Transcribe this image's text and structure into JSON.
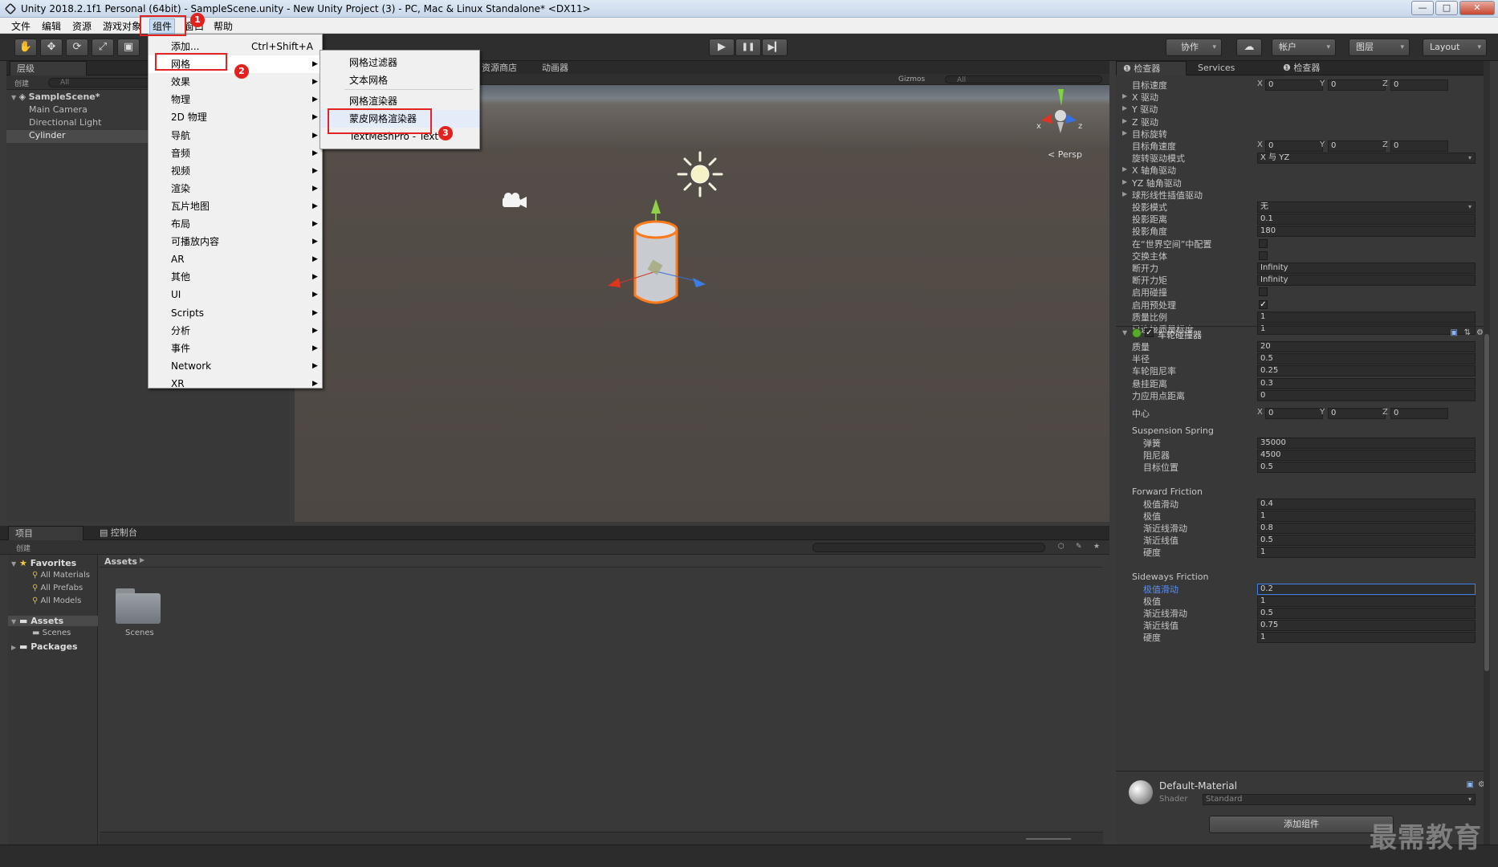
{
  "window": {
    "title": "Unity 2018.2.1f1 Personal (64bit) - SampleScene.unity - New Unity Project (3) - PC, Mac & Linux Standalone* <DX11>",
    "minimize": "—",
    "maximize": "□",
    "close": "✕"
  },
  "menubar": {
    "items": [
      "文件",
      "编辑",
      "资源",
      "游戏对象",
      "组件",
      "窗口",
      "帮助"
    ]
  },
  "toolbar": {
    "play": "▶",
    "pause": "❚❚",
    "step": "▶▎",
    "collab": "协作",
    "cloud": "☁",
    "account": "帐户",
    "layers": "图层",
    "layout": "Layout"
  },
  "hierarchy": {
    "tab": "层级",
    "create": "创建",
    "search_placeholder": "All",
    "scene": "SampleScene*",
    "items": [
      "Main Camera",
      "Directional Light",
      "Cylinder"
    ]
  },
  "scene_view": {
    "tabs": [
      "资源商店",
      "动画器"
    ],
    "gizmos": "Gizmos",
    "search_placeholder": "All",
    "persp_label": "Persp",
    "axis_x": "x",
    "axis_z": "z"
  },
  "component_menu": {
    "items": [
      {
        "label": "添加...",
        "shortcut": "Ctrl+Shift+A",
        "submenu": false
      },
      {
        "label": "网格",
        "submenu": true
      },
      {
        "label": "效果",
        "submenu": true
      },
      {
        "label": "物理",
        "submenu": true
      },
      {
        "label": "2D 物理",
        "submenu": true
      },
      {
        "label": "导航",
        "submenu": true
      },
      {
        "label": "音频",
        "submenu": true
      },
      {
        "label": "视频",
        "submenu": true
      },
      {
        "label": "渲染",
        "submenu": true
      },
      {
        "label": "瓦片地图",
        "submenu": true
      },
      {
        "label": "布局",
        "submenu": true
      },
      {
        "label": "可播放内容",
        "submenu": true
      },
      {
        "label": "AR",
        "submenu": true
      },
      {
        "label": "其他",
        "submenu": true
      },
      {
        "label": "UI",
        "submenu": true
      },
      {
        "label": "Scripts",
        "submenu": true
      },
      {
        "label": "分析",
        "submenu": true
      },
      {
        "label": "事件",
        "submenu": true
      },
      {
        "label": "Network",
        "submenu": true
      },
      {
        "label": "XR",
        "submenu": true
      }
    ]
  },
  "mesh_submenu": {
    "items": [
      "网格过滤器",
      "文本网格",
      "网格渲染器",
      "蒙皮网格渲染器",
      "TextMeshPro - Text"
    ]
  },
  "annotations": [
    "1",
    "2",
    "3"
  ],
  "inspector": {
    "tabs": [
      "检查器",
      "Services",
      "检查器"
    ],
    "rows": [
      {
        "label": "目标速度",
        "type": "xyz",
        "x": "0",
        "y": "0",
        "z": "0"
      },
      {
        "label": "X 驱动",
        "type": "fold"
      },
      {
        "label": "Y 驱动",
        "type": "fold"
      },
      {
        "label": "Z 驱动",
        "type": "fold"
      },
      {
        "label": "目标旋转",
        "type": "fold"
      },
      {
        "label": "目标角速度",
        "type": "xyz",
        "x": "0",
        "y": "0",
        "z": "0"
      },
      {
        "label": "旋转驱动模式",
        "type": "dropdown",
        "value": "X 与 YZ"
      },
      {
        "label": "X 轴角驱动",
        "type": "fold"
      },
      {
        "label": "YZ 轴角驱动",
        "type": "fold"
      },
      {
        "label": "球形线性插值驱动",
        "type": "fold"
      },
      {
        "label": "投影模式",
        "type": "dropdown",
        "value": "无"
      },
      {
        "label": "投影距离",
        "type": "field",
        "value": "0.1"
      },
      {
        "label": "投影角度",
        "type": "field",
        "value": "180"
      },
      {
        "label": "在“世界空间”中配置",
        "type": "check",
        "checked": false
      },
      {
        "label": "交换主体",
        "type": "check",
        "checked": false
      },
      {
        "label": "断开力",
        "type": "field",
        "value": "Infinity"
      },
      {
        "label": "断开力矩",
        "type": "field",
        "value": "Infinity"
      },
      {
        "label": "启用碰撞",
        "type": "check",
        "checked": false
      },
      {
        "label": "启用预处理",
        "type": "check",
        "checked": true
      },
      {
        "label": "质量比例",
        "type": "field",
        "value": "1"
      },
      {
        "label": "已连接质量标度",
        "type": "field",
        "value": "1"
      }
    ],
    "wheel_collider": {
      "title": "车轮碰撞器",
      "rows": [
        {
          "label": "质量",
          "value": "20"
        },
        {
          "label": "半径",
          "value": "0.5"
        },
        {
          "label": "车轮阻尼率",
          "value": "0.25"
        },
        {
          "label": "悬挂距离",
          "value": "0.3"
        },
        {
          "label": "力应用点距离",
          "value": "0"
        }
      ],
      "center": {
        "label": "中心",
        "x": "0",
        "y": "0",
        "z": "0"
      },
      "suspension": {
        "title": "Suspension Spring",
        "rows": [
          {
            "label": "弹簧",
            "value": "35000"
          },
          {
            "label": "阻尼器",
            "value": "4500"
          },
          {
            "label": "目标位置",
            "value": "0.5"
          }
        ]
      },
      "forward": {
        "title": "Forward Friction",
        "rows": [
          {
            "label": "极值滑动",
            "value": "0.4"
          },
          {
            "label": "极值",
            "value": "1"
          },
          {
            "label": "渐近线滑动",
            "value": "0.8"
          },
          {
            "label": "渐近线值",
            "value": "0.5"
          },
          {
            "label": "硬度",
            "value": "1"
          }
        ]
      },
      "sideways": {
        "title": "Sideways Friction",
        "rows": [
          {
            "label": "极值滑动",
            "value": "0.2"
          },
          {
            "label": "极值",
            "value": "1"
          },
          {
            "label": "渐近线滑动",
            "value": "0.5"
          },
          {
            "label": "渐近线值",
            "value": "0.75"
          },
          {
            "label": "硬度",
            "value": "1"
          }
        ]
      }
    },
    "material": {
      "name": "Default-Material",
      "shader_label": "Shader",
      "shader_value": "Standard"
    },
    "add_component": "添加组件"
  },
  "project": {
    "tabs": [
      "项目",
      "控制台"
    ],
    "create": "创建",
    "favorites": "Favorites",
    "favorite_items": [
      "All Materials",
      "All Prefabs",
      "All Models"
    ],
    "assets": "Assets",
    "asset_children": [
      "Scenes"
    ],
    "packages": "Packages",
    "breadcrumb": "Assets",
    "folder_name": "Scenes"
  },
  "watermark": "最需教育",
  "colors": {
    "highlight_red": "#e32222",
    "selection_blue": "#3d7eea",
    "menu_bg": "#f0f0f0"
  }
}
